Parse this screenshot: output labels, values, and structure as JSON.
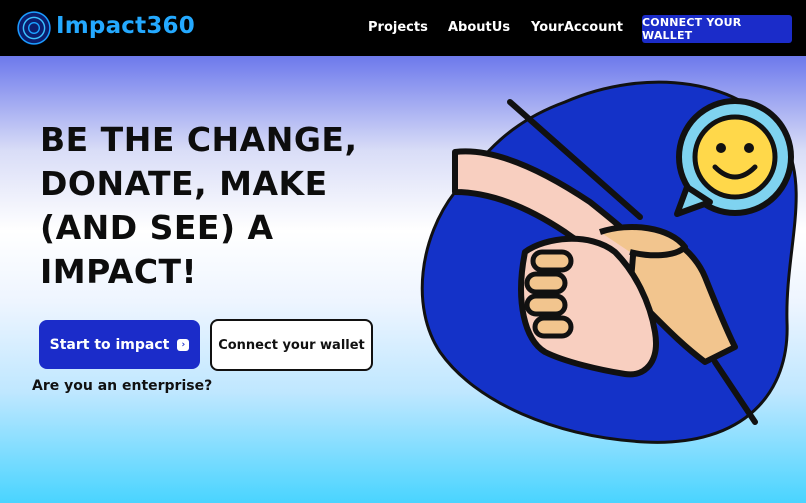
{
  "brand": {
    "name": "Impact360",
    "logo_icon": "galaxy-logo-icon",
    "color": "#24a9ff"
  },
  "nav": {
    "links": [
      "Projects",
      "AboutUs",
      "YourAccount"
    ],
    "cta": "CONNECT YOUR WALLET"
  },
  "hero": {
    "headline": {
      "line1": "BE THE CHANGE,",
      "line2": "DONATE, MAKE",
      "line3_strong": "(AND SEE)",
      "line3_rest": " A",
      "line4": "IMPACT!"
    },
    "primary_button": "Start to impact",
    "primary_icon": "arrow-right-icon",
    "secondary_button": "Connect your wallet",
    "enterprise_link": "Are you an enterprise?",
    "illustration_icons": [
      "handshake-icon",
      "smiley-chat-bubble-icon"
    ]
  },
  "colors": {
    "accent": "#1b2cc9",
    "blob": "#1432c8",
    "nav_bg": "#000000"
  }
}
